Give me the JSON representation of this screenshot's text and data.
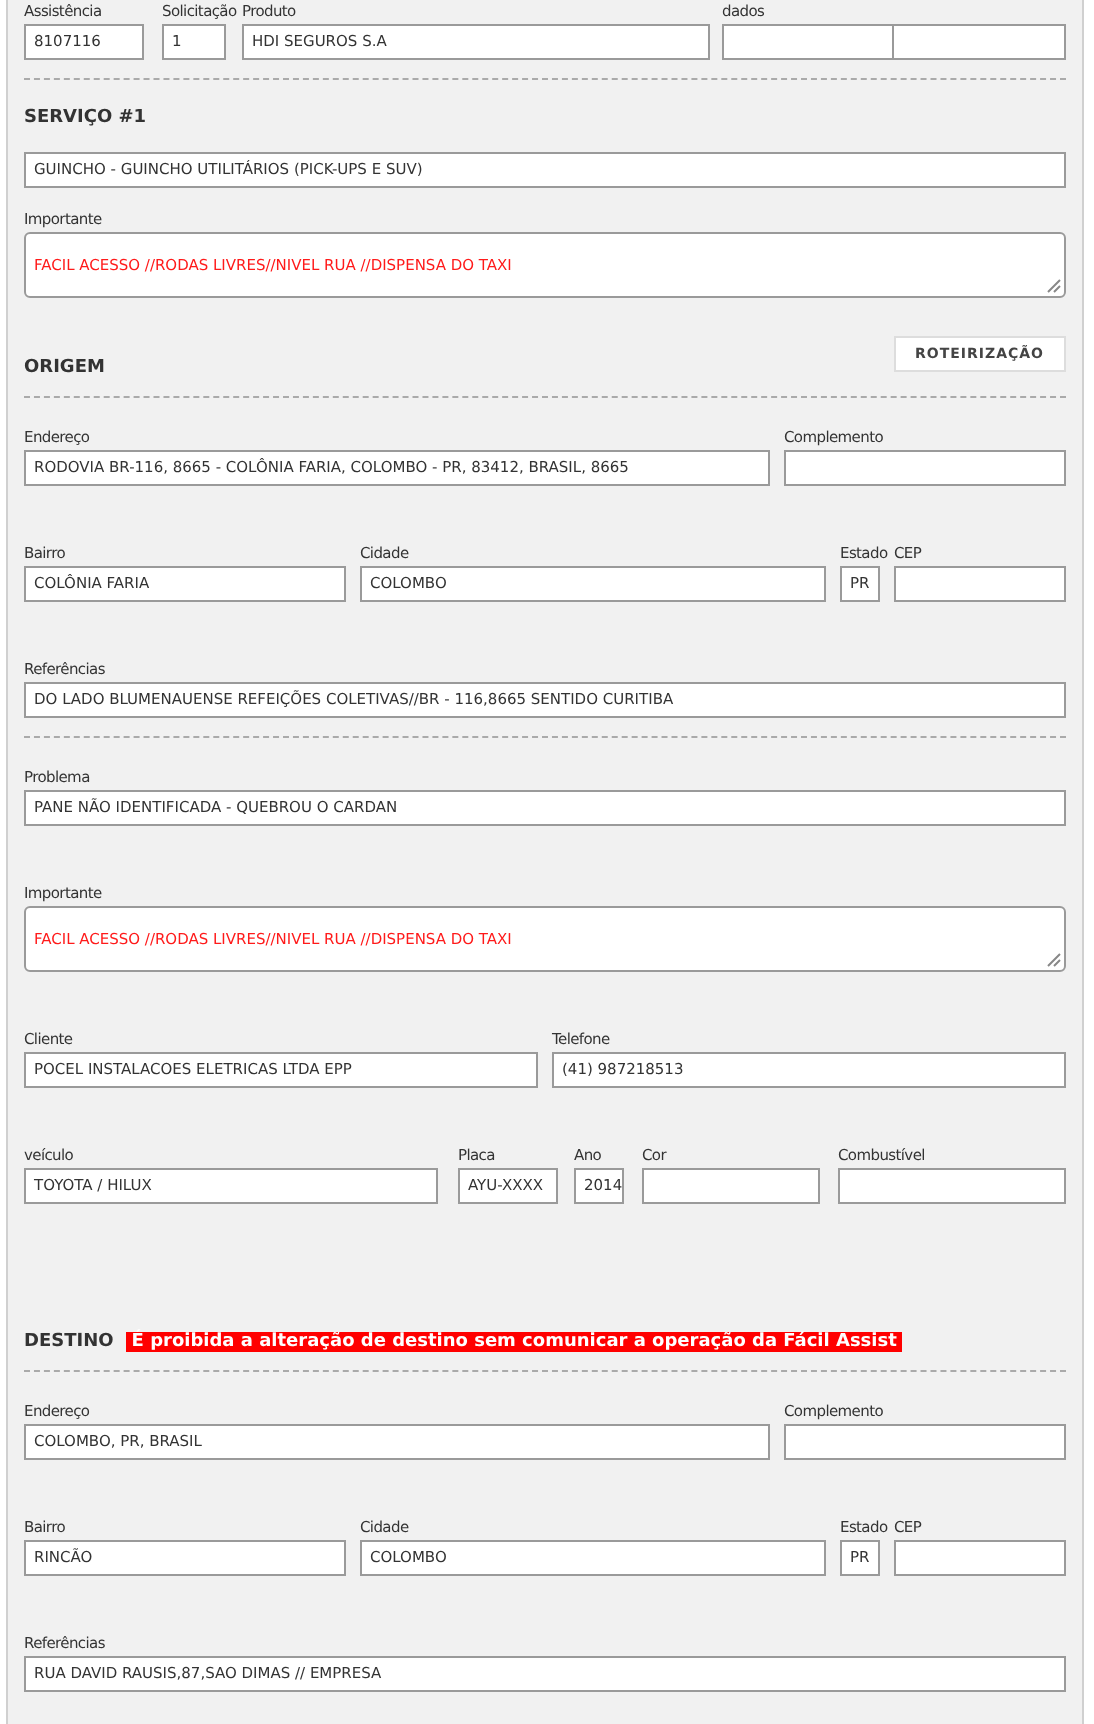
{
  "blocks": [
    {
      "kind": "ids",
      "fields": [
        {
          "label": "Assistência",
          "value": "8107116"
        },
        {
          "label": "Solicitação",
          "value": "1"
        },
        {
          "label": "Produto",
          "value": "HDI SEGUROS S.A"
        },
        {
          "label": "dados",
          "kind": "split"
        }
      ]
    },
    {
      "kind": "divider"
    },
    {
      "kind": "heading",
      "title": "SERVIÇO #1"
    },
    {
      "kind": "full",
      "fields": [
        {
          "value": "GUINCHO - GUINCHO UTILITÁRIOS (PICK-UPS E SUV)"
        }
      ]
    },
    {
      "kind": "full",
      "fields": [
        {
          "label": "Importante",
          "kind": "textarea",
          "value": "FACIL ACESSO //RODAS LIVRES//NIVEL RUA //DISPENSA DO TAXI"
        }
      ]
    },
    {
      "kind": "heading",
      "title": "ORIGEM",
      "button": "ROTEIRIZAÇÃO"
    },
    {
      "kind": "divider"
    },
    {
      "kind": "address",
      "fields": [
        {
          "label": "Endereço",
          "value": "RODOVIA BR-116, 8665 - COLÔNIA FARIA, COLOMBO - PR, 83412, BRASIL, 8665"
        },
        {
          "label": "Complemento"
        }
      ]
    },
    {
      "kind": "location",
      "fields": [
        {
          "label": "Bairro",
          "value": "COLÔNIA FARIA"
        },
        {
          "label": "Cidade",
          "value": "COLOMBO"
        },
        {
          "label": "Estado",
          "value": "PR"
        },
        {
          "label": "CEP"
        }
      ]
    },
    {
      "kind": "full",
      "fields": [
        {
          "label": "Referências",
          "value": "DO LADO BLUMENAUENSE REFEIÇÕES COLETIVAS//BR - 116,8665 SENTIDO CURITIBA"
        }
      ]
    },
    {
      "kind": "divider"
    },
    {
      "kind": "full",
      "fields": [
        {
          "label": "Problema",
          "value": "PANE NÃO IDENTIFICADA - QUEBROU O CARDAN"
        }
      ]
    },
    {
      "kind": "full",
      "fields": [
        {
          "label": "Importante",
          "kind": "textarea",
          "value": "FACIL ACESSO //RODAS LIVRES//NIVEL RUA //DISPENSA DO TAXI"
        }
      ]
    },
    {
      "kind": "client",
      "fields": [
        {
          "label": "Cliente",
          "value": "POCEL INSTALACOES ELETRICAS LTDA EPP"
        },
        {
          "label": "Telefone",
          "value": "(41) 987218513"
        }
      ]
    },
    {
      "kind": "vehicle",
      "fields": [
        {
          "label": "veículo",
          "value": "TOYOTA / HILUX"
        },
        {
          "label": "Placa",
          "value": "AYU-XXXX"
        },
        {
          "label": "Ano",
          "value": "2014"
        },
        {
          "label": "Cor"
        },
        {
          "label": "Combustível"
        }
      ]
    },
    {
      "kind": "heading",
      "title": "DESTINO",
      "warning": "É proibida a alteração de destino sem comunicar a operação da Fácil Assist"
    },
    {
      "kind": "divider"
    },
    {
      "kind": "address",
      "fields": [
        {
          "label": "Endereço",
          "value": "COLOMBO, PR, BRASIL"
        },
        {
          "label": "Complemento"
        }
      ]
    },
    {
      "kind": "location",
      "fields": [
        {
          "label": "Bairro",
          "value": "RINCÃO"
        },
        {
          "label": "Cidade",
          "value": "COLOMBO"
        },
        {
          "label": "Estado",
          "value": "PR"
        },
        {
          "label": "CEP"
        }
      ]
    },
    {
      "kind": "full",
      "fields": [
        {
          "label": "Referências",
          "value": "RUA DAVID RAUSIS,87,SAO DIMAS // EMPRESA"
        }
      ]
    }
  ]
}
